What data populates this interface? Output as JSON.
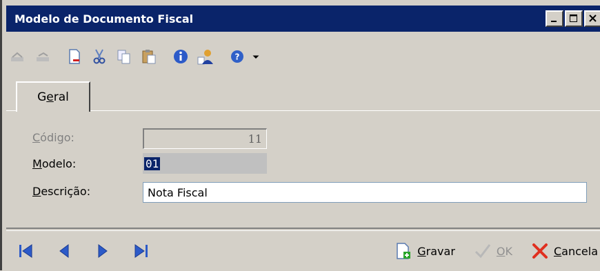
{
  "window": {
    "title": "Modelo de Documento Fiscal",
    "controls": [
      "minimize",
      "maximize",
      "close"
    ]
  },
  "toolbar": {
    "icons": [
      "first-record-icon",
      "previous-record-icon",
      "new-document-icon",
      "cut-icon",
      "copy-icon",
      "paste-icon",
      "info-icon",
      "user-icon",
      "help-icon",
      "dropdown-arrow-icon"
    ]
  },
  "tabs": [
    {
      "pre": "G",
      "acc": "e",
      "post": "ral"
    }
  ],
  "form": {
    "codigo": {
      "acc": "C",
      "label_rest": "ódigo:",
      "value": "11"
    },
    "modelo": {
      "acc": "M",
      "label_rest": "odelo:",
      "value": "01"
    },
    "descricao": {
      "acc": "D",
      "label_rest": "escrição:",
      "value": "Nota Fiscal"
    }
  },
  "bottom": {
    "gravar": {
      "acc": "G",
      "rest": "ravar"
    },
    "ok": {
      "acc": "O",
      "rest": "K"
    },
    "cancela": {
      "acc": "C",
      "rest": "ancela"
    }
  },
  "colors": {
    "titlebar": "#0a246a",
    "nav_blue": "#2c5ac8",
    "cancel_red": "#e03020",
    "gravar_green": "#2aa52a"
  }
}
